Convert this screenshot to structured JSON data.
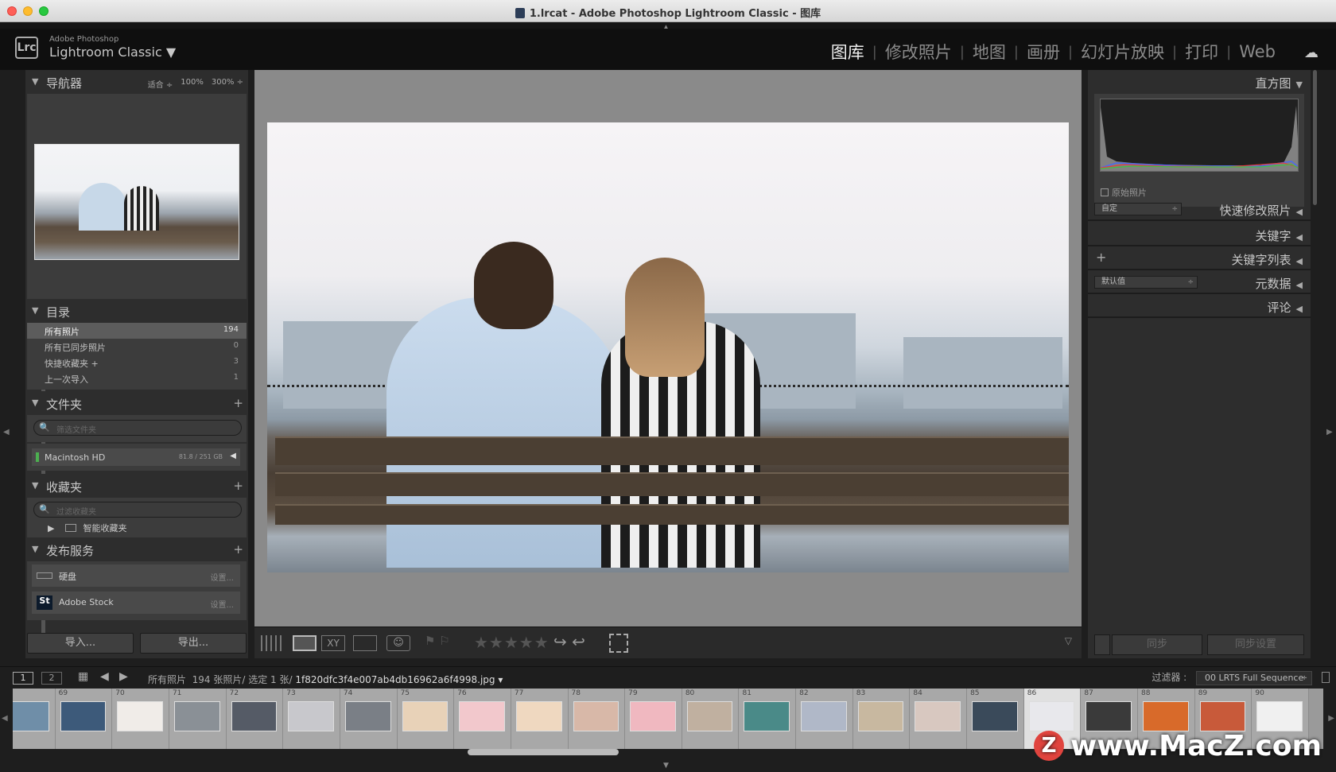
{
  "window": {
    "title": "1.lrcat - Adobe Photoshop Lightroom Classic - 图库"
  },
  "brand": {
    "line1": "Adobe Photoshop",
    "line2": "Lightroom Classic ▼",
    "logo": "Lrc"
  },
  "modules": [
    "图库",
    "修改照片",
    "地图",
    "画册",
    "幻灯片放映",
    "打印",
    "Web"
  ],
  "navigator": {
    "title": "导航器",
    "opts": [
      "适合 ÷",
      "100%",
      "300% ÷"
    ]
  },
  "catalog": {
    "title": "目录",
    "items": [
      {
        "label": "所有照片",
        "count": "194"
      },
      {
        "label": "所有已同步照片",
        "count": "0"
      },
      {
        "label": "快捷收藏夹 +",
        "count": "3"
      },
      {
        "label": "上一次导入",
        "count": "1"
      }
    ]
  },
  "folders": {
    "title": "文件夹",
    "search_placeholder": "筛选文件夹",
    "drive_name": "Macintosh HD",
    "drive_size": "81.8 / 251 GB"
  },
  "collections": {
    "title": "收藏夹",
    "search_placeholder": "过滤收藏夹",
    "smart": "智能收藏夹"
  },
  "publish": {
    "title": "发布服务",
    "services": [
      {
        "name": "硬盘",
        "action": "设置..."
      },
      {
        "name": "Adobe Stock",
        "action": "设置..."
      }
    ]
  },
  "buttons": {
    "import": "导入...",
    "export": "导出...",
    "sync": "同步",
    "sync_settings": "同步设置"
  },
  "right": {
    "histogram": "直方图",
    "original": "原始照片",
    "quick_develop": "快速修改照片",
    "quick_preset": "自定",
    "keywording": "关键字",
    "keyword_list": "关键字列表",
    "metadata": "元数据",
    "metadata_preset": "默认值",
    "comments": "评论"
  },
  "filmbar": {
    "monitor1": "1",
    "monitor2": "2",
    "source": "所有照片",
    "info": "194 张照片/ 选定 1 张/",
    "filename": "1f820dfc3f4e007ab4db16962a6f4998.jpg ▾",
    "filter_label": "过滤器 :",
    "filter_value": "00 LRTS Full Sequence"
  },
  "filmstrip": {
    "numbers": [
      "",
      "69",
      "70",
      "71",
      "72",
      "73",
      "74",
      "75",
      "76",
      "77",
      "78",
      "79",
      "80",
      "81",
      "82",
      "83",
      "84",
      "85",
      "86",
      "87",
      "88",
      "89",
      "90"
    ],
    "selected_index": 18,
    "colors": [
      "#6f8ea8",
      "#3d5a7a",
      "#f0ece8",
      "#8a9096",
      "#555b66",
      "#c8c8cc",
      "#7a7f86",
      "#e8d2b8",
      "#f2c8cc",
      "#efd8c0",
      "#d8b8a8",
      "#f0b8c0",
      "#c0b0a0",
      "#4a8a88",
      "#b0b8c8",
      "#c8b8a0",
      "#d8c8c0",
      "#3a4a5a",
      "#e8e8ec",
      "#3a3a3a",
      "#d86a2a",
      "#c85a3a",
      "#f0f0f0"
    ]
  },
  "watermark": "www.MacZ.com"
}
